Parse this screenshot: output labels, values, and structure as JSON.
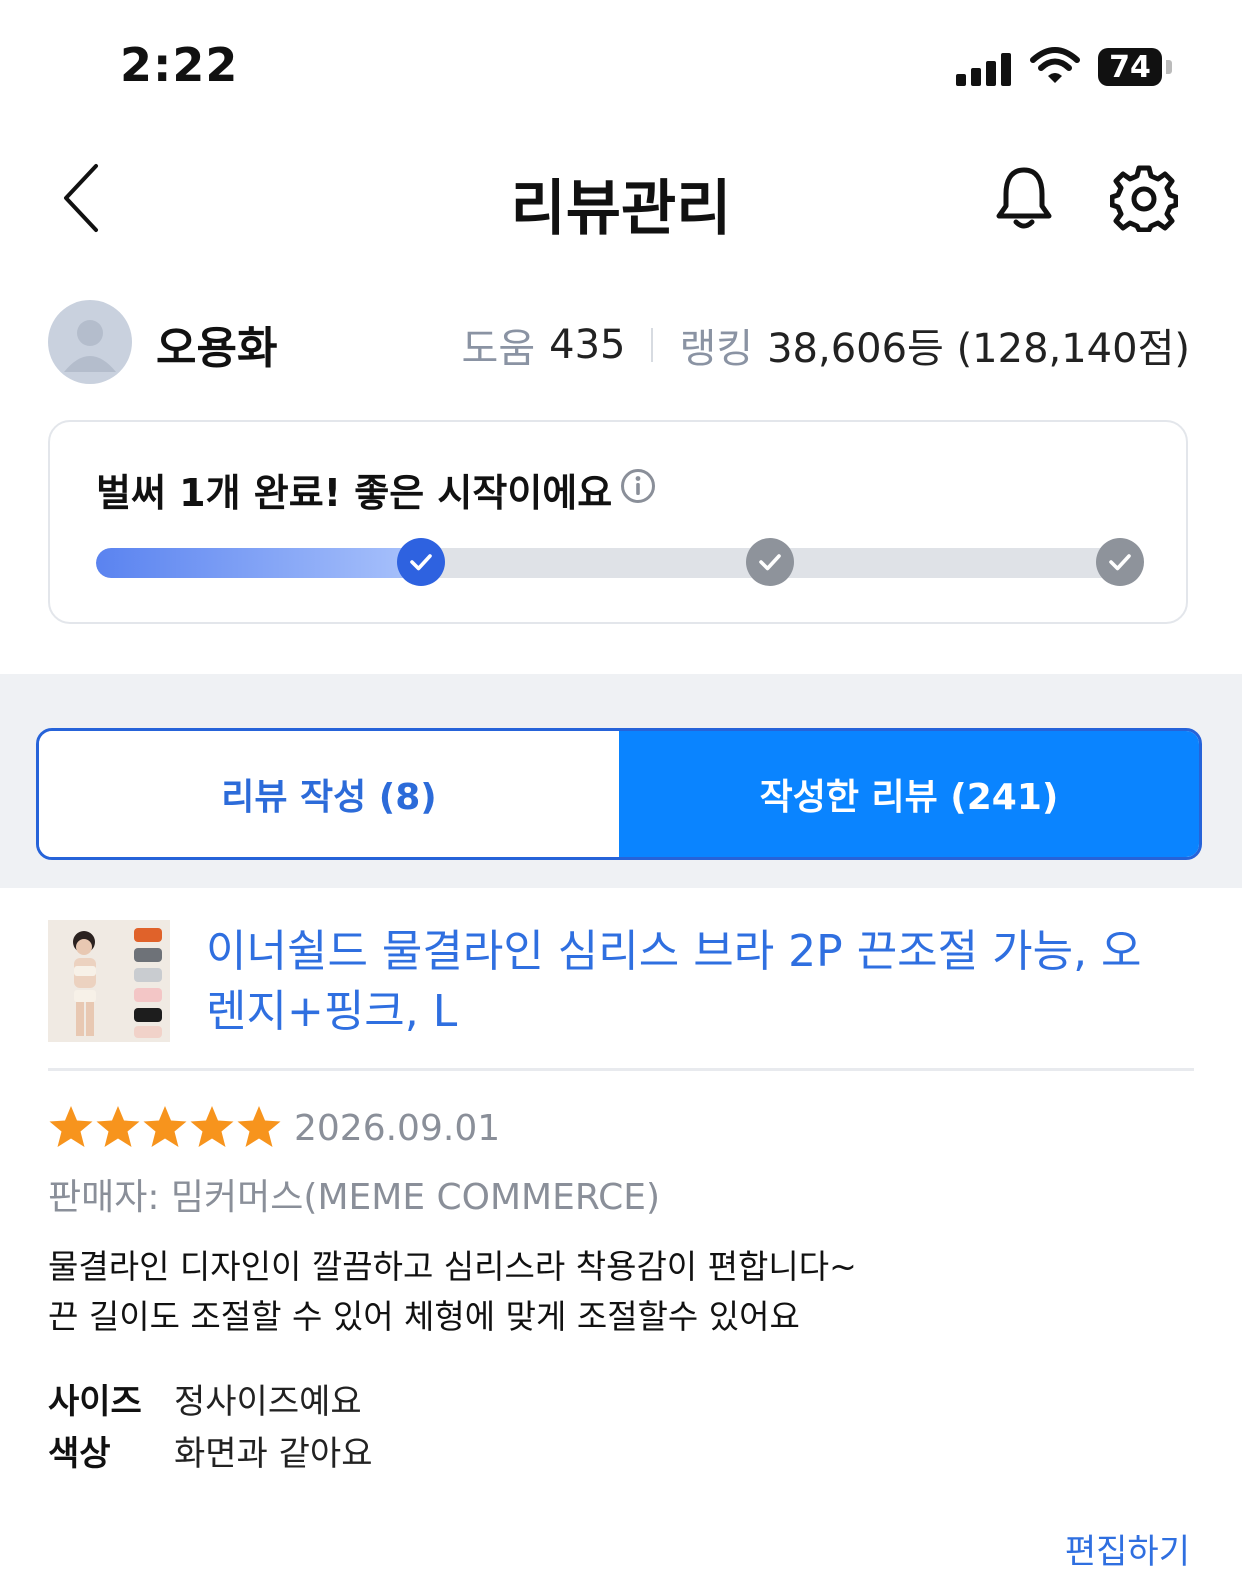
{
  "status_bar": {
    "time": "2:22",
    "battery": "74"
  },
  "header": {
    "title": "리뷰관리"
  },
  "profile": {
    "name": "오용화",
    "help_label": "도움",
    "help_value": "435",
    "rank_label": "랭킹",
    "rank_value": "38,606등 (128,140점)"
  },
  "progress": {
    "message": "벌써 1개 완료! 좋은 시작이에요",
    "fill_fraction": 0.31,
    "steps_completed": 1,
    "steps_total": 3
  },
  "tabs": {
    "write": "리뷰 작성 (8)",
    "written": "작성한 리뷰 (241)",
    "active": "written"
  },
  "product": {
    "name": "이너쉴드 물결라인 심리스 브라 2P 끈조절 가능, 오렌지+핑크, L"
  },
  "review": {
    "rating": 5,
    "date": "2026.09.01",
    "seller": "판매자: 밈커머스(MEME COMMERCE)",
    "body_line1": "물결라인 디자인이 깔끔하고 심리스라 착용감이 편합니다~",
    "body_line2": "끈 길이도 조절할 수 있어 체형에 맞게 조절할수 있어요",
    "attributes": [
      {
        "key": "사이즈",
        "value": "정사이즈예요"
      },
      {
        "key": "색상",
        "value": "화면과 같아요"
      }
    ],
    "edit_label": "편집하기"
  },
  "colors": {
    "accent_blue": "#0a84ff",
    "link_blue": "#2f6fe0",
    "star": "#f7941d",
    "step_active": "#2e62e0",
    "step_inactive": "#8e939b"
  }
}
